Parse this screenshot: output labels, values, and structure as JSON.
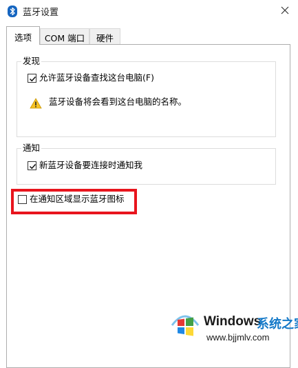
{
  "window": {
    "title": "蓝牙设置",
    "icon": "bluetooth-icon",
    "close_icon": "close-icon"
  },
  "tabs": [
    {
      "label": "选项",
      "active": true
    },
    {
      "label": "COM 端口",
      "active": false
    },
    {
      "label": "硬件",
      "active": false
    }
  ],
  "discovery": {
    "group_label": "发现",
    "allow_find_label": "允许蓝牙设备查找这台电脑(F)",
    "allow_find_checked": true,
    "warning_icon": "warning-icon",
    "warning_text": "蓝牙设备将会看到这台电脑的名称。"
  },
  "notifications": {
    "group_label": "通知",
    "notify_label": "新蓝牙设备要连接时通知我",
    "notify_checked": true
  },
  "tray": {
    "show_icon_label": "在通知区域显示蓝牙图标",
    "show_icon_checked": false
  },
  "annotation": {
    "highlight_color": "#e8141d"
  },
  "watermark": {
    "title": "Windows",
    "brand": "系统之家",
    "url": "www.bjjmlv.com"
  }
}
